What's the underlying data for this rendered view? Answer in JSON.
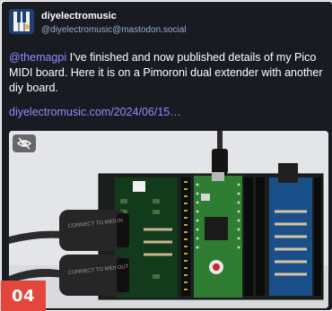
{
  "post": {
    "author": {
      "display_name": "diyelectromusic",
      "handle": "@diyelectromusic@mastodon.social"
    },
    "text": {
      "mention": "@themagpi",
      "body": " I've finished and now published details of my Pico MIDI board.  Here it is on a Pimoroni dual extender with another diy board."
    },
    "link": "diyelectromusic.com/2024/06/15…",
    "media": {
      "connector_label_1": "CONNECT TO MIDI IN",
      "connector_label_2": "CONNECT TO MIDI OUT"
    }
  },
  "badge": {
    "number": "04"
  },
  "icons": {
    "avatar": "piano-keys-avatar",
    "hide_media": "eye-slash-icon"
  },
  "colors": {
    "card_background": "#191b22",
    "link": "#8c8dff",
    "handle": "#9baec8",
    "badge": "#e3463d",
    "pcb": "#123b1c",
    "pico": "#2e7d32"
  }
}
